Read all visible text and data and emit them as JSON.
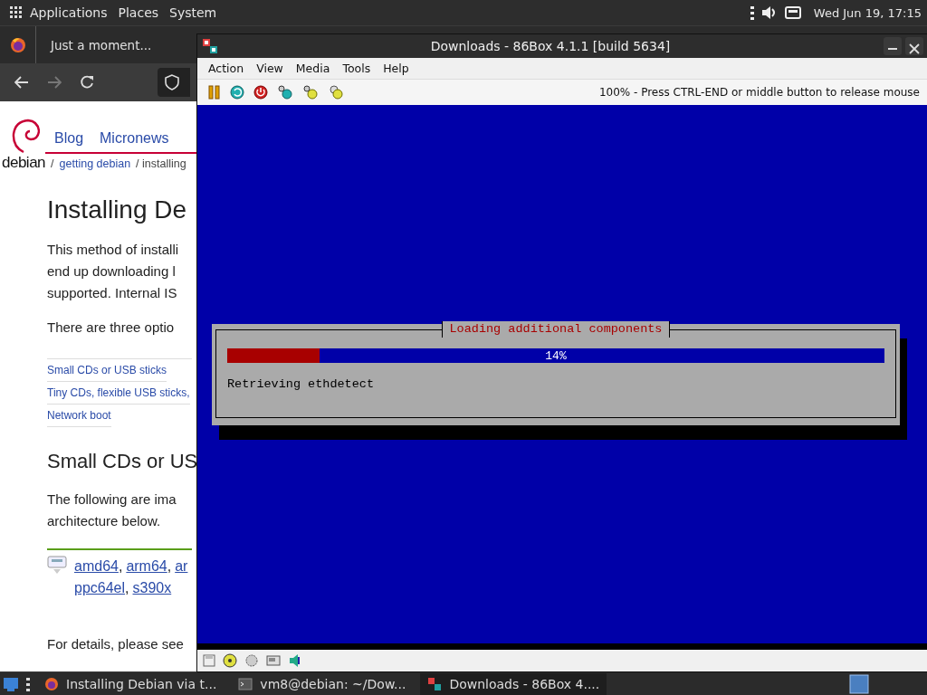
{
  "top_panel": {
    "menus": [
      "Applications",
      "Places",
      "System"
    ],
    "clock": "Wed Jun 19, 17:15"
  },
  "browser": {
    "tab_title": "Just a moment...",
    "site_nav": [
      "Blog",
      "Micronews"
    ],
    "site_name": "debian",
    "breadcrumb": [
      {
        "kind": "separator",
        "text": "/"
      },
      {
        "kind": "link",
        "text": "getting debian"
      },
      {
        "kind": "text",
        "text": "/ installing"
      }
    ],
    "heading": "Installing De",
    "intro_lines": [
      "This method of installi",
      "end up downloading l",
      "supported. Internal IS"
    ],
    "options_text": "There are three optio",
    "toc": [
      "Small CDs or USB sticks",
      "Tiny CDs, flexible USB sticks,",
      "Network boot"
    ],
    "section_heading": "Small CDs or US",
    "section_lines": [
      "The following are ima",
      "architecture below."
    ],
    "arch_separator": ",",
    "arch_lines": [
      [
        "amd64",
        "arm64",
        "ar"
      ],
      [
        "ppc64el",
        "s390x"
      ]
    ],
    "footer_text": "For details, please see"
  },
  "emulator_window": {
    "title": "Downloads - 86Box 4.1.1 [build 5634]",
    "menus": [
      "Action",
      "View",
      "Media",
      "Tools",
      "Help"
    ],
    "status_message": "100% - Press CTRL-END or middle button to release mouse",
    "dialog": {
      "title": "Loading additional components",
      "progress": {
        "level": 0.14,
        "reading": "14%"
      },
      "message": "Retrieving ethdetect"
    }
  },
  "taskbar": {
    "tasks": [
      {
        "kind": "browser",
        "label": "Installing Debian via t...",
        "selected": false
      },
      {
        "kind": "terminal",
        "label": "vm8@debian: ~/Dow...",
        "selected": false
      },
      {
        "kind": "emulator",
        "label": "Downloads - 86Box 4....",
        "selected": true
      }
    ]
  }
}
